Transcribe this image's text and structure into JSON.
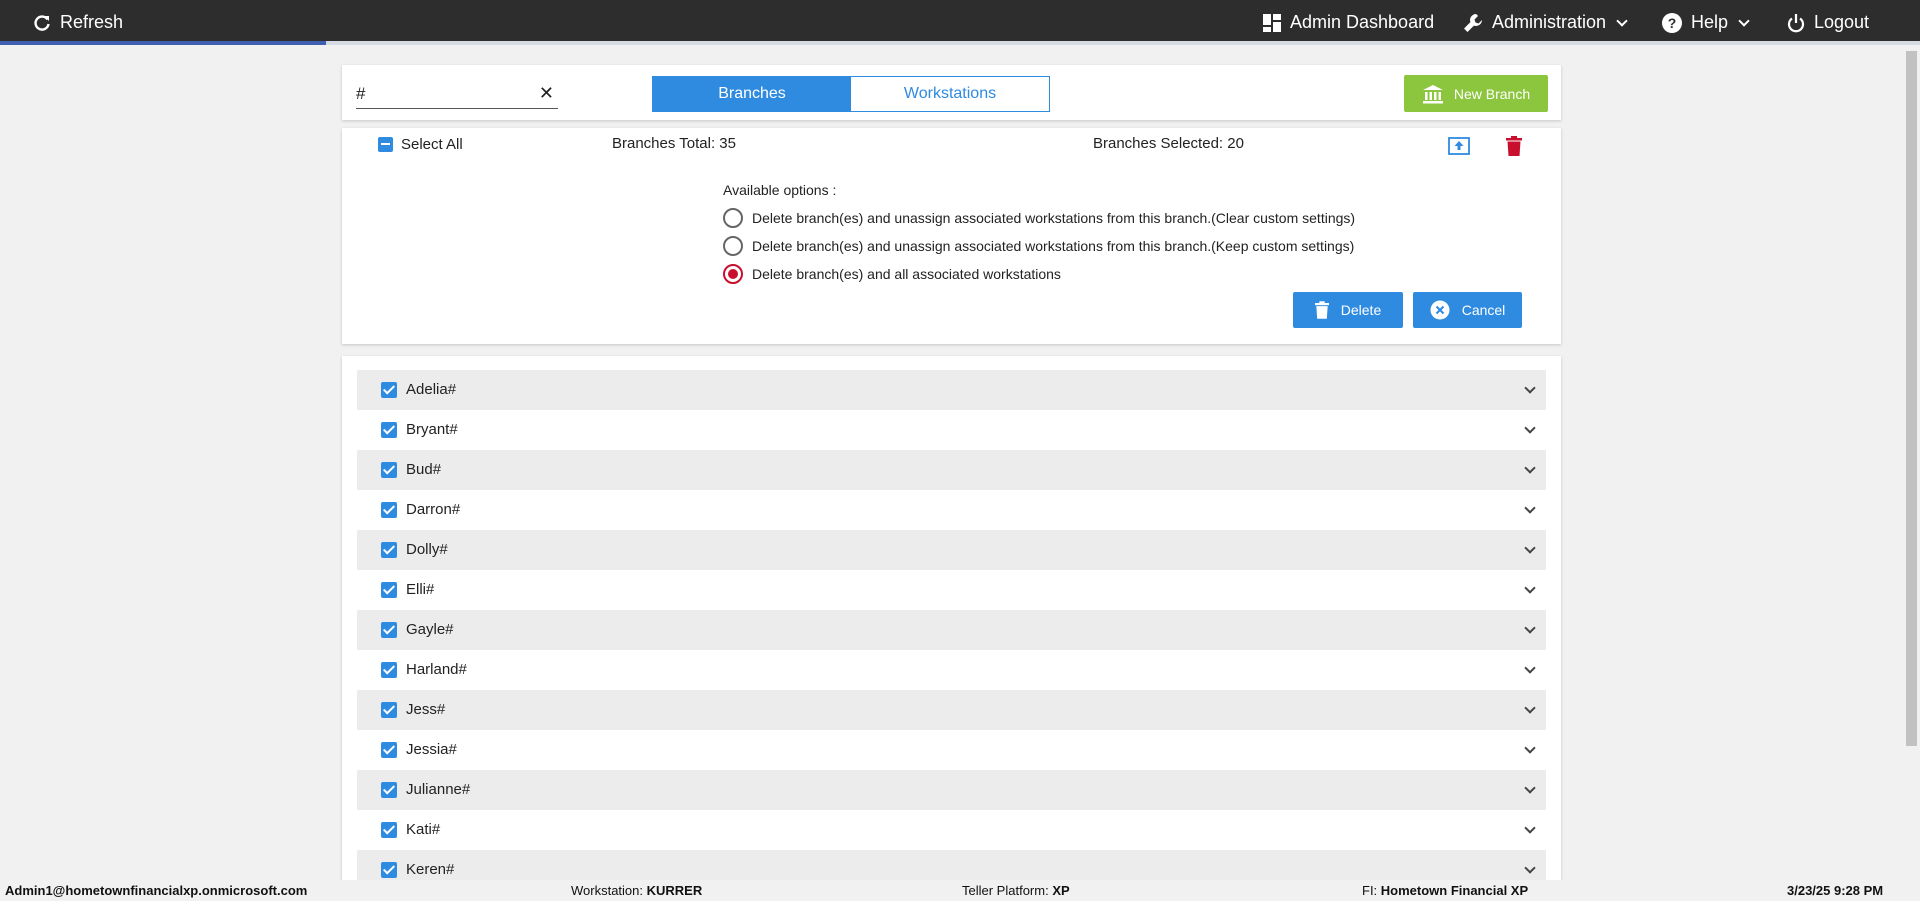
{
  "nav": {
    "refresh": "Refresh",
    "admin_dashboard": "Admin Dashboard",
    "administration": "Administration",
    "help": "Help",
    "logout": "Logout",
    "progress_fraction": 0.17
  },
  "filter": {
    "search_value": "#",
    "tabs": [
      {
        "label": "Branches",
        "active": true
      },
      {
        "label": "Workstations",
        "active": false
      }
    ],
    "new_branch": "New Branch"
  },
  "summary": {
    "select_all": "Select All",
    "branches_total": "Branches Total: 35",
    "branches_selected": "Branches Selected: 20"
  },
  "delete_options": {
    "heading": "Available options :",
    "options": [
      {
        "label": "Delete branch(es) and unassign associated workstations from this branch.(Clear custom settings)",
        "checked": false
      },
      {
        "label": "Delete branch(es) and unassign associated workstations from this branch.(Keep custom settings)",
        "checked": false
      },
      {
        "label": "Delete branch(es) and all associated workstations",
        "checked": true
      }
    ],
    "delete_label": "Delete",
    "cancel_label": "Cancel"
  },
  "branches": [
    {
      "name": "Adelia#",
      "checked": true
    },
    {
      "name": "Bryant#",
      "checked": true
    },
    {
      "name": "Bud#",
      "checked": true
    },
    {
      "name": "Darron#",
      "checked": true
    },
    {
      "name": "Dolly#",
      "checked": true
    },
    {
      "name": "Elli#",
      "checked": true
    },
    {
      "name": "Gayle#",
      "checked": true
    },
    {
      "name": "Harland#",
      "checked": true
    },
    {
      "name": "Jess#",
      "checked": true
    },
    {
      "name": "Jessia#",
      "checked": true
    },
    {
      "name": "Julianne#",
      "checked": true
    },
    {
      "name": "Kati#",
      "checked": true
    },
    {
      "name": "Keren#",
      "checked": true
    }
  ],
  "footer": {
    "user": "Admin1@hometownfinancialxp.onmicrosoft.com",
    "workstation_label": "Workstation: ",
    "workstation_value": "KURRER",
    "platform_label": "Teller Platform: ",
    "platform_value": "XP",
    "fi_label": "FI: ",
    "fi_value": "Hometown Financial XP",
    "datetime": "3/23/25 9:28 PM"
  },
  "colors": {
    "accent": "#2e8be0",
    "new_branch": "#8cc63f",
    "danger": "#c8102e",
    "topbar": "#2d2d2d"
  }
}
